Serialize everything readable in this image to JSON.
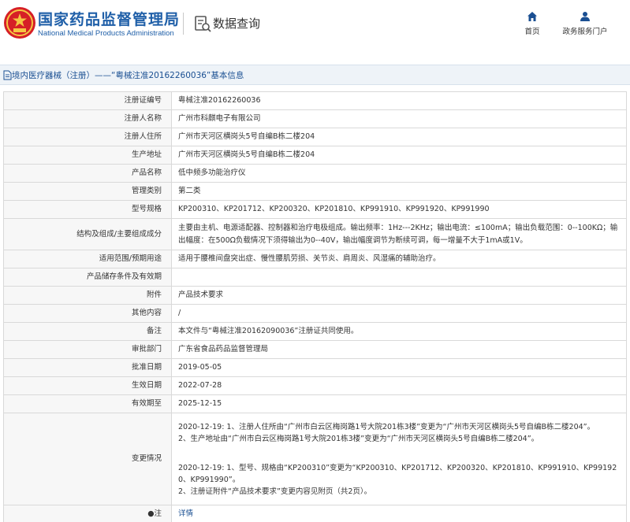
{
  "header": {
    "logo_cn": "国家药品监督管理局",
    "logo_en": "National Medical Products Administration",
    "query_title": "数据查询",
    "nav": [
      {
        "label": "首页",
        "icon": "home-icon"
      },
      {
        "label": "政务服务门户",
        "icon": "user-icon"
      }
    ]
  },
  "breadcrumb": {
    "text": "境内医疗器械（注册）——“粤械注准20162260036”基本信息"
  },
  "info": {
    "reg_no": {
      "label": "注册证编号",
      "value": "粤械注准20162260036"
    },
    "registrant": {
      "label": "注册人名称",
      "value": "广州市科麒电子有限公司"
    },
    "registrant_addr": {
      "label": "注册人住所",
      "value": "广州市天河区横岗头5号自编B栋二楼204"
    },
    "production_addr": {
      "label": "生产地址",
      "value": "广州市天河区横岗头5号自编B栋二楼204"
    },
    "product_name": {
      "label": "产品名称",
      "value": "低中频多功能治疗仪"
    },
    "mgmt_class": {
      "label": "管理类别",
      "value": "第二类"
    },
    "model_spec": {
      "label": "型号规格",
      "value": "KP200310、KP201712、KP200320、KP201810、KP991910、KP991920、KP991990"
    },
    "structure": {
      "label": "结构及组成/主要组成成分",
      "value": "主要由主机、电源适配器、控制器和治疗电极组成。输出频率：1Hz---2KHz；输出电流：≤100mA；输出负载范围：0--100KΩ；输出幅度：在500Ω负载情况下须得输出为0--40V，输出幅度调节为断续可调，每一增量不大于1mA或1V。"
    },
    "scope": {
      "label": "适用范围/预期用途",
      "value": "适用于腰椎间盘突出症、慢性腰肌劳损、关节炎、肩周炎、风湿痛的辅助治疗。"
    },
    "storage": {
      "label": "产品储存条件及有效期",
      "value": ""
    },
    "attachment": {
      "label": "附件",
      "value": "产品技术要求"
    },
    "other": {
      "label": "其他内容",
      "value": "/"
    },
    "remark": {
      "label": "备注",
      "value": "本文件与“粤械注准20162090036”注册证共同使用。"
    },
    "approval_dept": {
      "label": "审批部门",
      "value": "广东省食品药品监督管理局"
    },
    "approval_date": {
      "label": "批准日期",
      "value": "2019-05-05"
    },
    "effective_date": {
      "label": "生效日期",
      "value": "2022-07-28"
    },
    "expiry_date": {
      "label": "有效期至",
      "value": "2025-12-15"
    },
    "changes": {
      "label": "变更情况",
      "block1": "2020-12-19: 1、注册人住所由“广州市白云区梅岗路1号大院201栋3楼”变更为“广州市天河区横岗头5号自编B栋二楼204”。\n2、生产地址由“广州市白云区梅岗路1号大院201栋3楼”变更为“广州市天河区横岗头5号自编B栋二楼204”。",
      "block2": "2020-12-19: 1、型号、规格由“KP200310”变更为“KP200310、KP201712、KP200320、KP201810、KP991910、KP991920、KP991990”。\n2、注册证附件“产品技术要求”变更内容见附页（共2页）。"
    },
    "note": {
      "label": "●注",
      "value": "详情"
    }
  },
  "colors": {
    "brand_blue": "#1f5fa8",
    "link_blue": "#1a4f92",
    "key_cell_bg": "#f7f7f7",
    "crumb_bg": "#eef3f8"
  }
}
